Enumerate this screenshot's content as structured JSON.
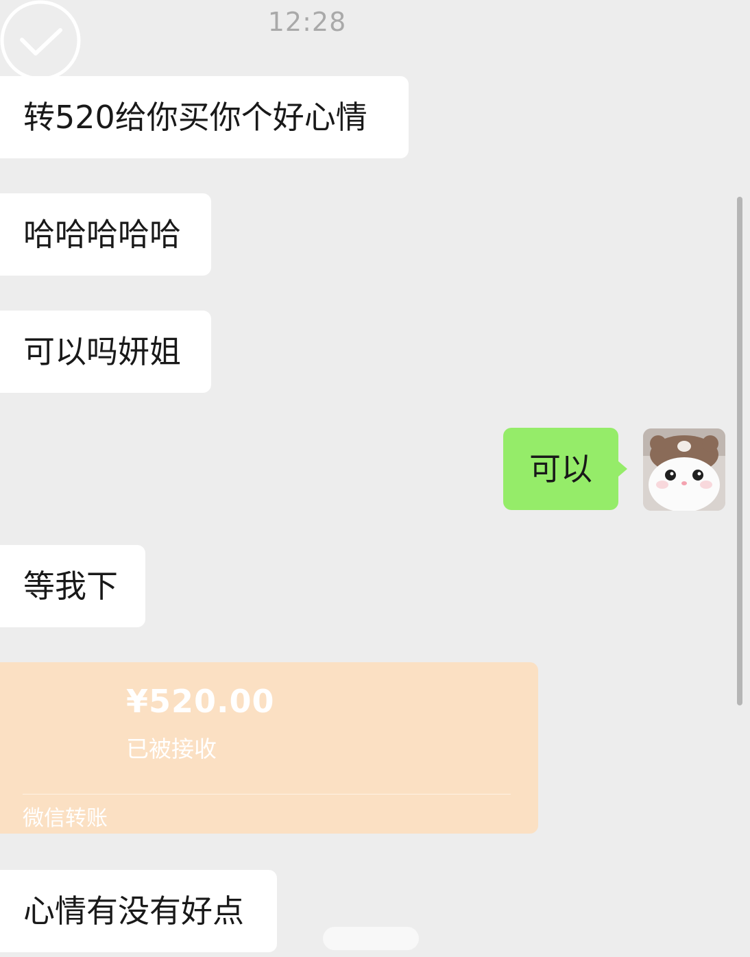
{
  "timestamp": "12:28",
  "messages": [
    {
      "side": "left",
      "text": "转520给你买你个好心情"
    },
    {
      "side": "left",
      "text": "哈哈哈哈哈"
    },
    {
      "side": "left",
      "text": "可以吗妍姐"
    },
    {
      "side": "right",
      "text": "可以"
    },
    {
      "side": "left",
      "text": "等我下"
    },
    {
      "side": "left",
      "text": "心情有没有好点"
    }
  ],
  "transfer": {
    "amount": "¥520.00",
    "status": "已被接收",
    "footer": "微信转账"
  },
  "avatar": {
    "icon": "cat-avatar-icon"
  }
}
